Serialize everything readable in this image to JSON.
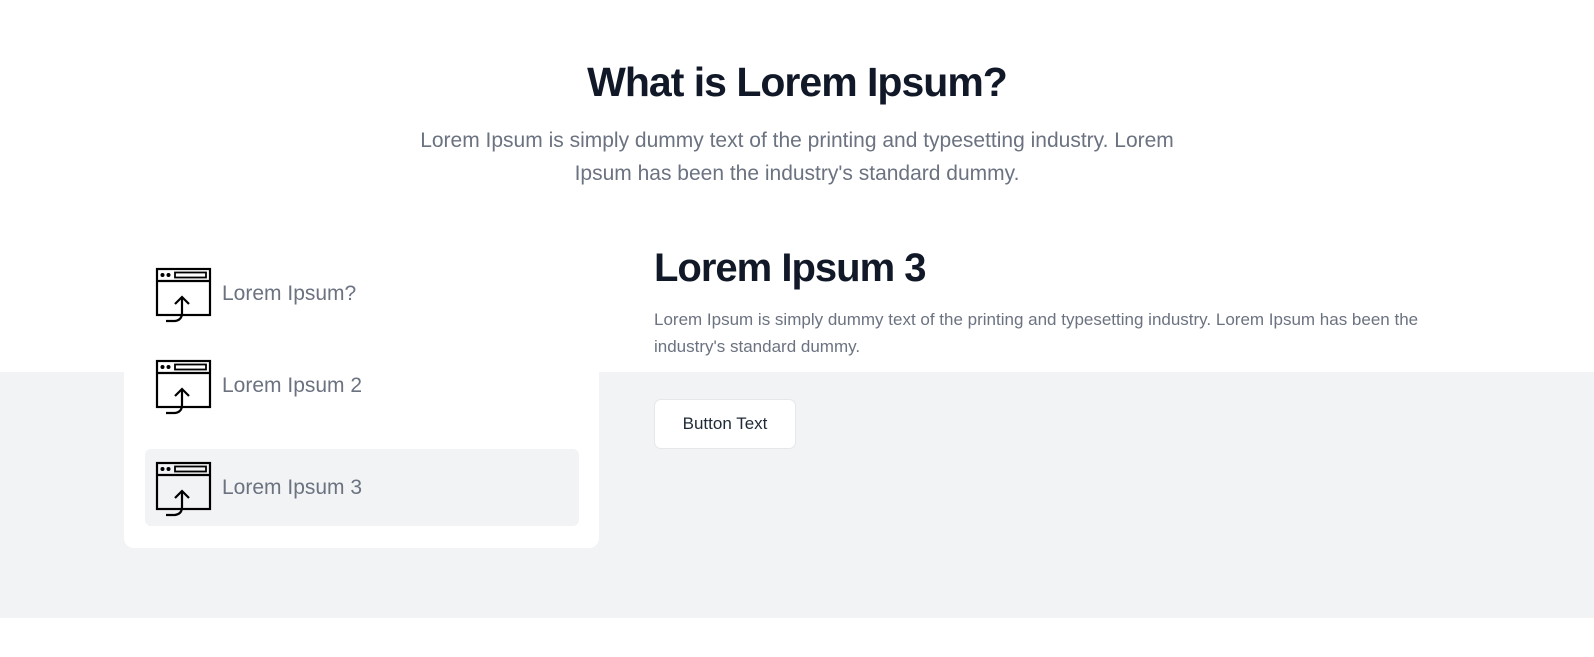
{
  "header": {
    "title": "What is Lorem Ipsum?",
    "subtitle": "Lorem Ipsum is simply dummy text of the printing and typesetting industry. Lorem Ipsum has been the industry's standard dummy."
  },
  "tabs": {
    "items": [
      {
        "label": "Lorem Ipsum?",
        "icon": "browser-upload-icon",
        "active": false
      },
      {
        "label": "Lorem Ipsum 2",
        "icon": "browser-upload-icon",
        "active": false
      },
      {
        "label": "Lorem Ipsum 3",
        "icon": "browser-upload-icon",
        "active": true
      }
    ]
  },
  "content": {
    "title": "Lorem Ipsum 3",
    "text": "Lorem Ipsum is simply dummy text of the printing and typesetting industry. Lorem Ipsum has been the industry's standard dummy.",
    "button_label": "Button Text"
  },
  "colors": {
    "heading": "#111827",
    "body_text": "#6b7280",
    "band_background": "#f2f3f5",
    "active_tab_background": "#f2f3f5"
  }
}
